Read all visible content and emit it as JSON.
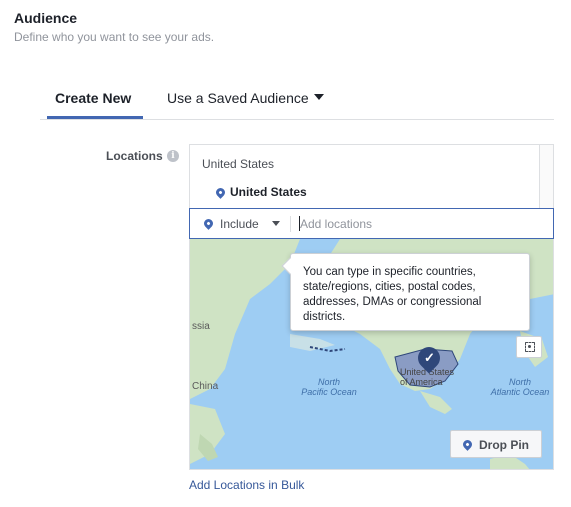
{
  "header": {
    "title": "Audience",
    "subtitle": "Define who you want to see your ads."
  },
  "tabs": [
    {
      "label": "Create New",
      "active": true
    },
    {
      "label": "Use a Saved Audience",
      "active": false
    }
  ],
  "locations": {
    "label": "Locations",
    "info_icon": "info-icon",
    "group_header": "United States",
    "selected": [
      "United States"
    ],
    "include_select": {
      "value": "Include"
    },
    "input": {
      "placeholder": "Add locations",
      "value": ""
    },
    "tooltip": "You can type in specific countries, state/regions, cities, postal codes, addresses, DMAs or congressional districts.",
    "map": {
      "ocean_labels": [
        {
          "line1": "North",
          "line2": "Pacific Ocean"
        },
        {
          "line1": "North",
          "line2": "Atlantic Ocean"
        }
      ],
      "land_labels": [
        "ssia",
        "China",
        "United States of America"
      ],
      "pin_label": "Drop Pin"
    },
    "bulk_link": "Add Locations in Bulk"
  },
  "colors": {
    "accent": "#4267b2",
    "link": "#365899",
    "ocean": "#9ecdf3",
    "land": "#cfe3c4",
    "selected_region": "#8a9cc4"
  }
}
